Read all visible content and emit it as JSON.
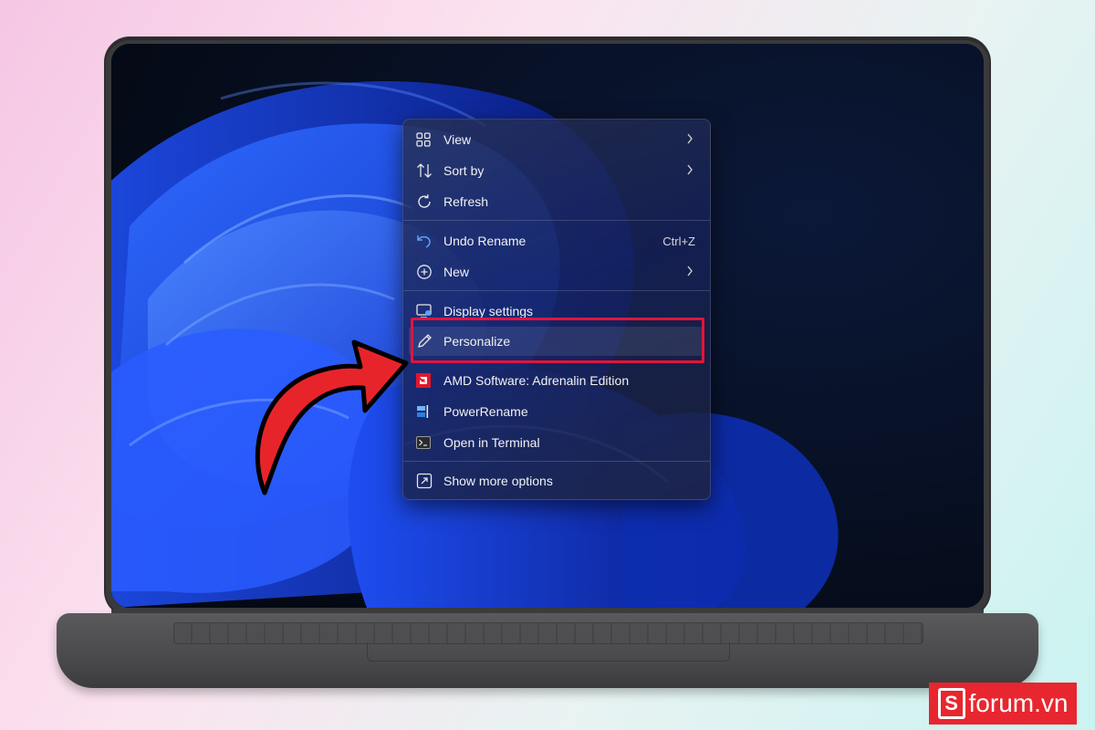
{
  "context_menu": {
    "items": [
      {
        "label": "View",
        "icon": "view-grid-icon",
        "submenu": true
      },
      {
        "label": "Sort by",
        "icon": "sort-icon",
        "submenu": true
      },
      {
        "label": "Refresh",
        "icon": "refresh-icon"
      },
      {
        "label": "Undo Rename",
        "icon": "undo-icon",
        "shortcut": "Ctrl+Z"
      },
      {
        "label": "New",
        "icon": "plus-circle-icon",
        "submenu": true
      },
      {
        "label": "Display settings",
        "icon": "display-settings-icon"
      },
      {
        "label": "Personalize",
        "icon": "pencil-icon",
        "highlighted": true
      },
      {
        "label": "AMD Software: Adrenalin Edition",
        "icon": "amd-logo-icon"
      },
      {
        "label": "PowerRename",
        "icon": "powerrename-icon"
      },
      {
        "label": "Open in Terminal",
        "icon": "terminal-icon"
      },
      {
        "label": "Show more options",
        "icon": "show-more-icon"
      }
    ]
  },
  "annotation": {
    "highlight_color": "#e3143c",
    "arrow_color": "#e8242b"
  },
  "watermark": {
    "text": "forum.vn",
    "logo_letter": "S",
    "color": "#e8262f"
  }
}
